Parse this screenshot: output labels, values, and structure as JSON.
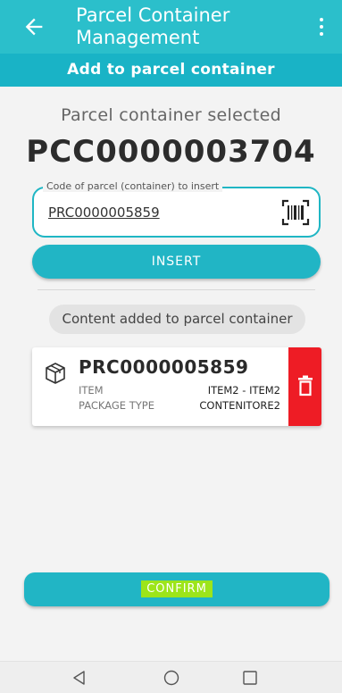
{
  "appbar": {
    "title": "Parcel Container Management",
    "back_icon": "arrow-back-icon",
    "menu_icon": "more-vert-icon"
  },
  "subheader": {
    "title": "Add to parcel container"
  },
  "selected": {
    "label": "Parcel container selected",
    "code": "PCC0000003704"
  },
  "insert_field": {
    "label": "Code of parcel (container) to insert",
    "value": "PRC0000005859",
    "scan_icon": "barcode-scan-icon"
  },
  "insert_button": {
    "label": "INSERT"
  },
  "content_chip": {
    "label": "Content added to parcel container"
  },
  "items": [
    {
      "code": "PRC0000005859",
      "icon": "package-icon",
      "item_label": "ITEM",
      "item_value": "ITEM2 - ITEM2",
      "package_type_label": "PACKAGE TYPE",
      "package_type_value": "CONTENITORE2",
      "delete_icon": "trash-icon"
    }
  ],
  "confirm_button": {
    "label": "CONFIRM"
  },
  "navbar": {
    "back": "nav-back-icon",
    "home": "nav-home-icon",
    "recents": "nav-recents-icon"
  },
  "colors": {
    "appbar": "#2bbfcb",
    "subheader": "#19b3c6",
    "button": "#21b5c5",
    "delete": "#ee1c25",
    "highlight": "#9ce51a"
  }
}
